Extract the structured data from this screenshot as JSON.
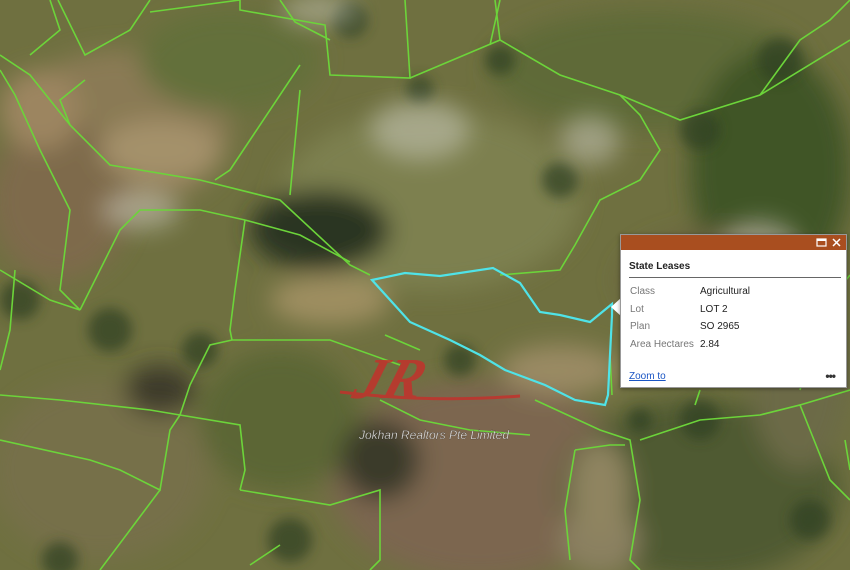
{
  "map": {
    "parcel_line_color": "#6cd43a",
    "selected_color": "#4fe3e8",
    "watermark_logo": "JR",
    "watermark_text": "Jokhan Realtors Pte Limited"
  },
  "popup": {
    "header_color": "#a94e1f",
    "title": "State Leases",
    "rows": [
      {
        "label": "Class",
        "value": "Agricultural"
      },
      {
        "label": "Lot",
        "value": "LOT 2"
      },
      {
        "label": "Plan",
        "value": "SO 2965"
      },
      {
        "label": "Area Hectares",
        "value": "2.84"
      }
    ],
    "zoom_label": "Zoom to",
    "more_label": "•••",
    "icons": [
      "maximize-icon",
      "close-icon",
      "more-icon"
    ]
  }
}
